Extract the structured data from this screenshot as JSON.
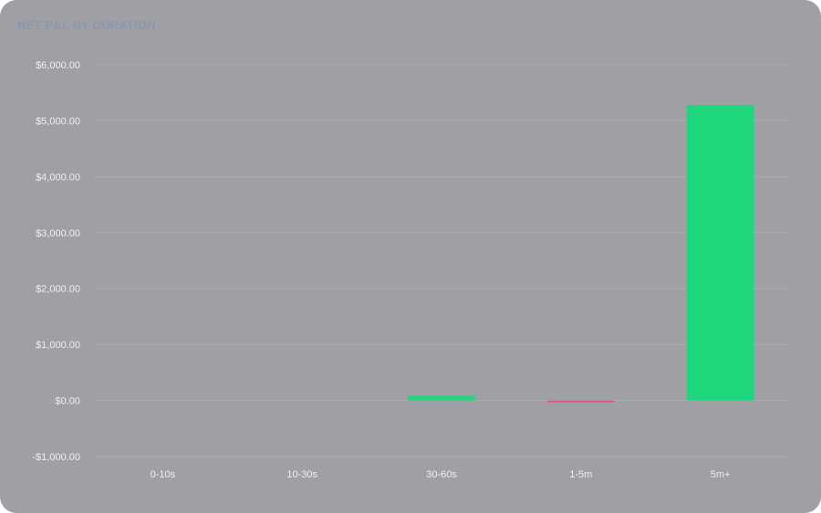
{
  "chart_data": {
    "type": "bar",
    "title": "NET P&L BY DURATION",
    "xlabel": "",
    "ylabel": "",
    "categories": [
      "0-10s",
      "10-30s",
      "30-60s",
      "1-5m",
      "5m+"
    ],
    "values": [
      0,
      0,
      85,
      -25,
      5280
    ],
    "ylim": [
      -1000,
      6000
    ],
    "yticks": [
      {
        "value": 6000,
        "label": "$6,000.00"
      },
      {
        "value": 5000,
        "label": "$5,000.00"
      },
      {
        "value": 4000,
        "label": "$4,000.00"
      },
      {
        "value": 3000,
        "label": "$3,000.00"
      },
      {
        "value": 2000,
        "label": "$2,000.00"
      },
      {
        "value": 1000,
        "label": "$1,000.00"
      },
      {
        "value": 0,
        "label": "$0.00"
      },
      {
        "value": -1000,
        "label": "-$1,000.00"
      }
    ],
    "grid": true,
    "legend": "none",
    "colors": {
      "positive": "#1fd67c",
      "negative": "#e0557a"
    }
  }
}
